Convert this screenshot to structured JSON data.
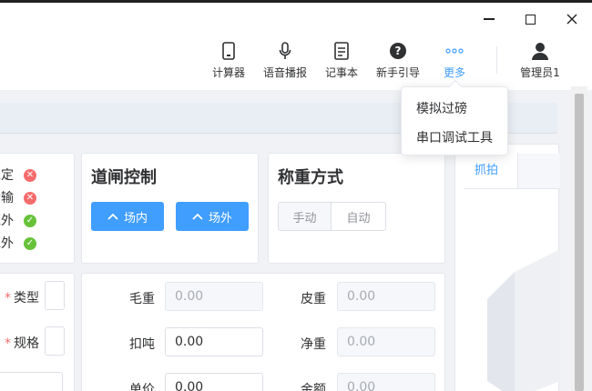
{
  "colors": {
    "primary": "#409eff",
    "danger": "#f56c6c",
    "success": "#67c23a"
  },
  "window_controls": {
    "minimize": "minimize",
    "maximize": "maximize",
    "close": "close"
  },
  "toolbar": {
    "calculator": "计算器",
    "voice": "语音播报",
    "notepad": "记事本",
    "guide": "新手引导",
    "more": "更多",
    "user": "管理员1"
  },
  "more_menu": {
    "items": [
      "模拟过磅",
      "串口调试工具"
    ]
  },
  "status": {
    "rows": [
      {
        "label": "稳定",
        "state": "error"
      },
      {
        "label": "传输",
        "state": "error"
      },
      {
        "label": "红外",
        "state": "ok"
      },
      {
        "label": "红外",
        "state": "ok"
      }
    ]
  },
  "gate": {
    "title": "道闸控制",
    "in_label": "场内",
    "out_label": "场外"
  },
  "weigh_mode": {
    "title": "称重方式",
    "manual": "手动",
    "auto": "自动"
  },
  "vehicle": {
    "type_label": "类型",
    "spec_label": "规格"
  },
  "weights": {
    "gross_label": "毛重",
    "gross_value": "0.00",
    "tare_label": "皮重",
    "tare_value": "0.00",
    "deduct_label": "扣吨",
    "deduct_value": "0.00",
    "net_label": "净重",
    "net_value": "0.00",
    "price_label": "单价",
    "price_value": "0.00",
    "amount_label": "金额",
    "amount_value": "0.00"
  },
  "right_panel": {
    "tab_capture": "抓拍"
  }
}
